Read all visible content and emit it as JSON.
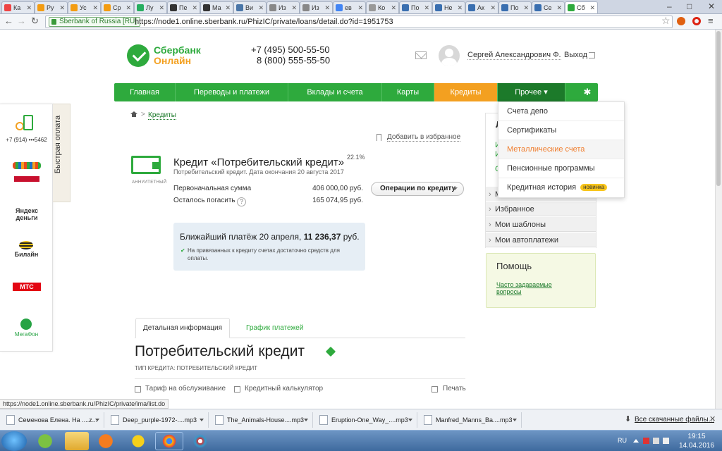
{
  "browser": {
    "tabs": [
      {
        "label": "Ка",
        "color": "#e44"
      },
      {
        "label": "Ру",
        "color": "#f39c12"
      },
      {
        "label": "Ус",
        "color": "#f39c12"
      },
      {
        "label": "Ср",
        "color": "#f39c12"
      },
      {
        "label": "Лу",
        "color": "#27ae60"
      },
      {
        "label": "Пе",
        "color": "#333"
      },
      {
        "label": "Ма",
        "color": "#333"
      },
      {
        "label": "Ви",
        "color": "#4a76a8"
      },
      {
        "label": "Из",
        "color": "#888"
      },
      {
        "label": "Из",
        "color": "#888"
      },
      {
        "label": "ев",
        "color": "#4285f4"
      },
      {
        "label": "Ко",
        "color": "#999"
      },
      {
        "label": "По",
        "color": "#3a6fb0"
      },
      {
        "label": "Не",
        "color": "#3a6fb0"
      },
      {
        "label": "Ак",
        "color": "#3a6fb0"
      },
      {
        "label": "По",
        "color": "#3a6fb0"
      },
      {
        "label": "Се",
        "color": "#3a6fb0"
      },
      {
        "label": "Сб",
        "color": "#2eaa3d"
      }
    ],
    "ev_badge": "Sberbank of Russia [RU]",
    "url": "https://node1.online.sberbank.ru/PhizIC/private/loans/detail.do?id=1951753",
    "status_url": "https://node1.online.sberbank.ru/PhizIC/private/ima/list.do"
  },
  "header": {
    "logo_line1": "Сбербанк",
    "logo_line2": "Онлайн",
    "phone1": "+7 (495) 500-55-50",
    "phone2": "8 (800) 555-55-50",
    "username": "Сергей Александрович Ф.",
    "logout": "Выход"
  },
  "nav": {
    "items": [
      "Главная",
      "Переводы и платежи",
      "Вклады и счета",
      "Карты",
      "Кредиты",
      "Прочее ▾"
    ],
    "gear": "✱"
  },
  "dropdown": {
    "items": [
      "Счета депо",
      "Сертификаты",
      "Металлические счета",
      "Пенсионные программы",
      "Кредитная история"
    ],
    "badge": "новинка"
  },
  "breadcrumb": {
    "link": "Кредиты",
    "sep": ">"
  },
  "favorites_link": "Добавить в избранное",
  "credit": {
    "annuity_label": "АННУИТЕТНЫЙ",
    "title": "Кредит «Потребительский кредит»",
    "rate": "22.1%",
    "subtitle": "Потребительский кредит. Дата окончания 20 августа 2017",
    "initial_label": "Первоначальная сумма",
    "initial_value": "406 000,00 руб.",
    "remaining_label": "Осталось погасить",
    "remaining_value": "165 074,95 руб.",
    "help_mark": "?",
    "ops_button": "Операции по кредиту"
  },
  "payment": {
    "prefix": "Ближайший платёж 20 апреля, ",
    "amount": "11 236,37",
    "suffix": " руб.",
    "note": "На привязанных к кредиту счетах достаточно средств для оплаты."
  },
  "sidebar": {
    "heading_fragment": "Л",
    "fragments": [
      "И",
      "И",
      "С",
      "М"
    ],
    "items": [
      "Избранное",
      "Мои шаблоны",
      "Мои автоплатежи"
    ],
    "help_title": "Помощь",
    "help_link": "Часто задаваемые вопросы"
  },
  "tabs": {
    "detail": "Детальная информация",
    "schedule": "График платежей"
  },
  "details": {
    "title": "Потребительский кредит",
    "type_line": "ТИП КРЕДИТА: ПОТРЕБИТЕЛЬСКИЙ КРЕДИТ",
    "tariff_link": "Тариф на обслуживание",
    "calc_link": "Кредитный калькулятор",
    "print_link": "Печать"
  },
  "quickpay": {
    "label": "Быстрая оплата",
    "phone_text": "+7 (914) •••5462",
    "yandex": "Яндекс деньги",
    "beeline": "Билайн",
    "mts": "МТС",
    "megafon": "МегаФон"
  },
  "downloads": {
    "items": [
      "Семенова Елена. На ....z...",
      "Deep_purple-1972-....mp3",
      "The_Animals-House....mp3",
      "Eruption-One_Way_....mp3",
      "Manfred_Manns_Ba....mp3"
    ],
    "show_all": "Все скачанные файлы...",
    "close": "✕"
  },
  "taskbar": {
    "lang": "RU",
    "time": "19:15",
    "date": "14.04.2016"
  },
  "colors": {
    "brand_green": "#2eaa3d",
    "accent_orange": "#f3a020",
    "dark_green": "#1c7a2a"
  }
}
